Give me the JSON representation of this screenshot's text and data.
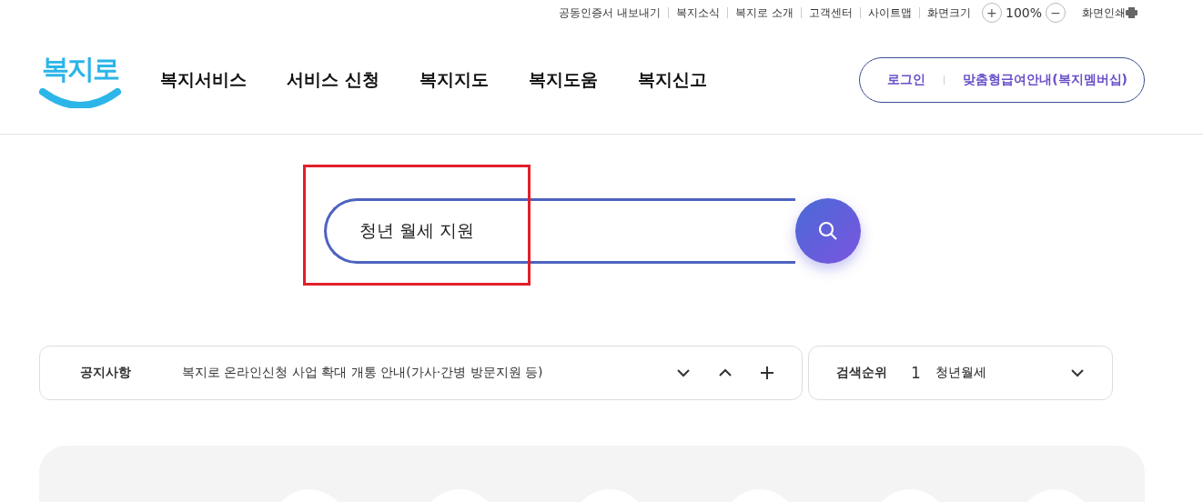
{
  "utility_bar": {
    "links": [
      "공동인증서 내보내기",
      "복지소식",
      "복지로 소개",
      "고객센터",
      "사이트맵"
    ],
    "zoom_label": "화면크기",
    "zoom_in": "+",
    "zoom_value": "100%",
    "zoom_out": "−",
    "print": "화면인쇄"
  },
  "header": {
    "logo": "복지로",
    "nav": [
      "복지서비스",
      "서비스 신청",
      "복지지도",
      "복지도움",
      "복지신고"
    ],
    "account_links": [
      "로그인",
      "맞춤형급여안내(복지멤버십)"
    ]
  },
  "search": {
    "value": "청년 월세 지원",
    "highlighted": true
  },
  "notice": {
    "label": "공지사항",
    "text": "복지로 온라인신청 사업 확대 개통 안내(가사·간병 방문지원 등)"
  },
  "search_ranking": {
    "label": "검색순위",
    "rank": "1",
    "term": "청년월세"
  }
}
